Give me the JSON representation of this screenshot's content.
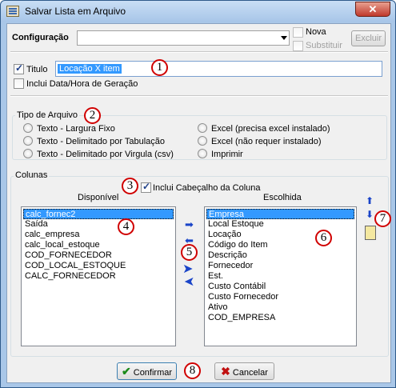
{
  "window": {
    "title": "Salvar Lista em Arquivo",
    "close_label": "✕"
  },
  "config": {
    "label": "Configuração",
    "nova": "Nova",
    "substituir": "Substituir",
    "excluir": "Excluir"
  },
  "titulo": {
    "label": "Titulo",
    "value": "Locação X item",
    "checked": true,
    "include_date_label": "Inclui Data/Hora de Geração"
  },
  "tipo_arquivo": {
    "label": "Tipo de Arquivo",
    "options": [
      "Texto - Largura Fixo",
      "Texto - Delimitado por Tabulação",
      "Texto - Delimitado por Virgula (csv)",
      "Excel (precisa excel instalado)",
      "Excel (não requer instalado)",
      "Imprimir"
    ]
  },
  "colunas": {
    "label": "Colunas",
    "include_header_label": "Inclui Cabeçalho da Coluna",
    "disponivel_label": "Disponível",
    "escolhida_label": "Escolhida",
    "disponivel": [
      "calc_fornec2",
      "Saída",
      "calc_empresa",
      "calc_local_estoque",
      "COD_FORNECEDOR",
      "COD_LOCAL_ESTOQUE",
      "CALC_FORNECEDOR"
    ],
    "escolhida": [
      "Empresa",
      "Local Estoque",
      "Locação",
      "Código do Item",
      "Descrição",
      "Fornecedor",
      "Est.",
      "Custo Contábil",
      "Custo Fornecedor",
      "Ativo",
      "COD_EMPRESA"
    ]
  },
  "buttons": {
    "confirmar": "Confirmar",
    "cancelar": "Cancelar"
  },
  "callouts": [
    "1",
    "2",
    "3",
    "4",
    "5",
    "6",
    "7",
    "8"
  ]
}
